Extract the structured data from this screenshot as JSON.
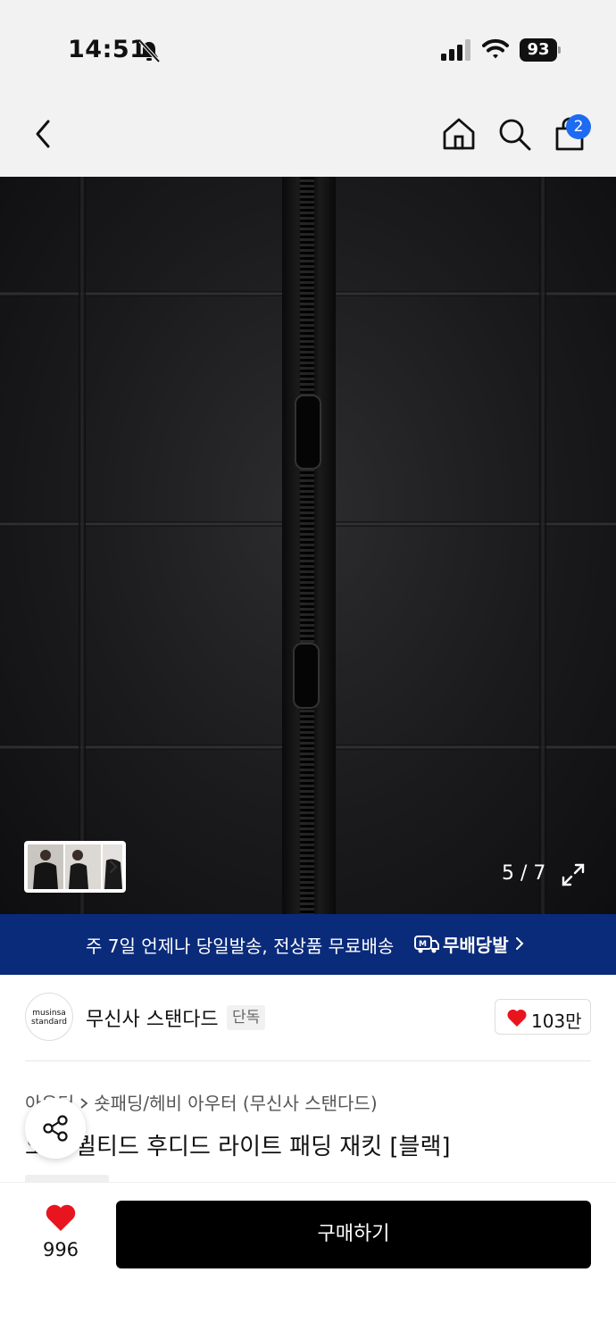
{
  "status_bar": {
    "time": "14:51",
    "battery": "93"
  },
  "nav": {
    "cart_count": "2"
  },
  "gallery": {
    "counter": "5 / 7"
  },
  "promo": {
    "text": "주 7일 언제나 당일발송, 전상품 무료배송",
    "label": "무배당발",
    "background": "#0a2a7a"
  },
  "brand": {
    "logo_text_line1": "musinsa",
    "logo_text_line2": "standard",
    "name": "무신사 스탠다드",
    "tag": "단독",
    "likes": "103만"
  },
  "product": {
    "category_1": "아우터",
    "category_2": "숏패딩/헤비 아우터 (무신사 스탠다드)",
    "title": "오버 퀼티드 후디드 라이트 패딩 재킷 [블랙]"
  },
  "bottom": {
    "wish_count": "996",
    "buy_label": "구매하기"
  },
  "colors": {
    "accent_badge": "#1e6bf2",
    "heart": "#e8141e",
    "buy": "#000000"
  }
}
